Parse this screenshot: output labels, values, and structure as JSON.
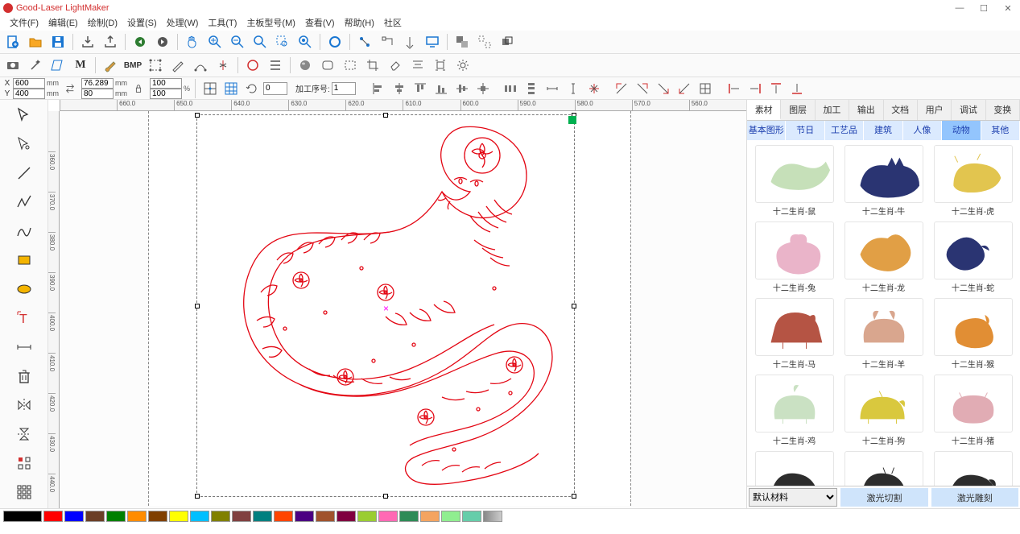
{
  "app": {
    "title": "Good-Laser LightMaker"
  },
  "menu": [
    "文件(F)",
    "编辑(E)",
    "绘制(D)",
    "设置(S)",
    "处理(W)",
    "工具(T)",
    "主板型号(M)",
    "查看(V)",
    "帮助(H)",
    "社区"
  ],
  "coords": {
    "x_label": "X",
    "y_label": "Y",
    "x": "600",
    "y": "400",
    "w": "76.289",
    "h": "80",
    "unit_mm": "mm",
    "sx": "100",
    "sy": "100",
    "unit_pct": "%",
    "rotate": "0",
    "procseq_label": "加工序号:",
    "procseq": "1"
  },
  "ruler_h": [
    "",
    "660.0",
    "650.0",
    "640.0",
    "630.0",
    "620.0",
    "610.0",
    "600.0",
    "590.0",
    "580.0",
    "570.0",
    "560.0"
  ],
  "ruler_v": [
    "",
    "360.0",
    "370.0",
    "380.0",
    "390.0",
    "400.0",
    "410.0",
    "420.0",
    "430.0",
    "440.0"
  ],
  "right": {
    "tabs": [
      "素材",
      "图层",
      "加工",
      "输出",
      "文档",
      "用户",
      "调试",
      "变换"
    ],
    "active_tab": 0,
    "cats": [
      "基本图形",
      "节日",
      "工艺品",
      "建筑",
      "人像",
      "动物",
      "其他"
    ],
    "active_cat": 5,
    "items": [
      {
        "label": "十二生肖-鼠",
        "color": "#c3dfb6"
      },
      {
        "label": "十二生肖-牛",
        "color": "#1f2a6b"
      },
      {
        "label": "十二生肖-虎",
        "color": "#e1c246"
      },
      {
        "label": "十二生肖-兔",
        "color": "#e9b0c7"
      },
      {
        "label": "十二生肖-龙",
        "color": "#e09a3c"
      },
      {
        "label": "十二生肖-蛇",
        "color": "#1f2a6b"
      },
      {
        "label": "十二生肖-马",
        "color": "#b24b3a"
      },
      {
        "label": "十二生肖-羊",
        "color": "#d7a288"
      },
      {
        "label": "十二生肖-猴",
        "color": "#e0892a"
      },
      {
        "label": "十二生肖-鸡",
        "color": "#c8e0c0"
      },
      {
        "label": "十二生肖-狗",
        "color": "#d8c634"
      },
      {
        "label": "十二生肖-猪",
        "color": "#e0a8b0"
      },
      {
        "label": "",
        "color": "#222"
      },
      {
        "label": "",
        "color": "#222"
      },
      {
        "label": "",
        "color": "#222"
      }
    ],
    "material_default": "默认材料",
    "actions": [
      "激光切割",
      "激光雕刻"
    ]
  },
  "colors": [
    "#000000",
    "#ff0000",
    "#0000ff",
    "#6b3e26",
    "#008000",
    "#ff8c00",
    "#804000",
    "#ffff00",
    "#00bfff",
    "#808000",
    "#804040",
    "#008080",
    "#ff4500",
    "#4b0082",
    "#a0522d",
    "#800040",
    "#9acd32",
    "#ff69b4",
    "#2e8b57",
    "#f4a460",
    "#90ee90",
    "#66cdaa"
  ],
  "bmp_text": "BMP",
  "m_text": "M"
}
